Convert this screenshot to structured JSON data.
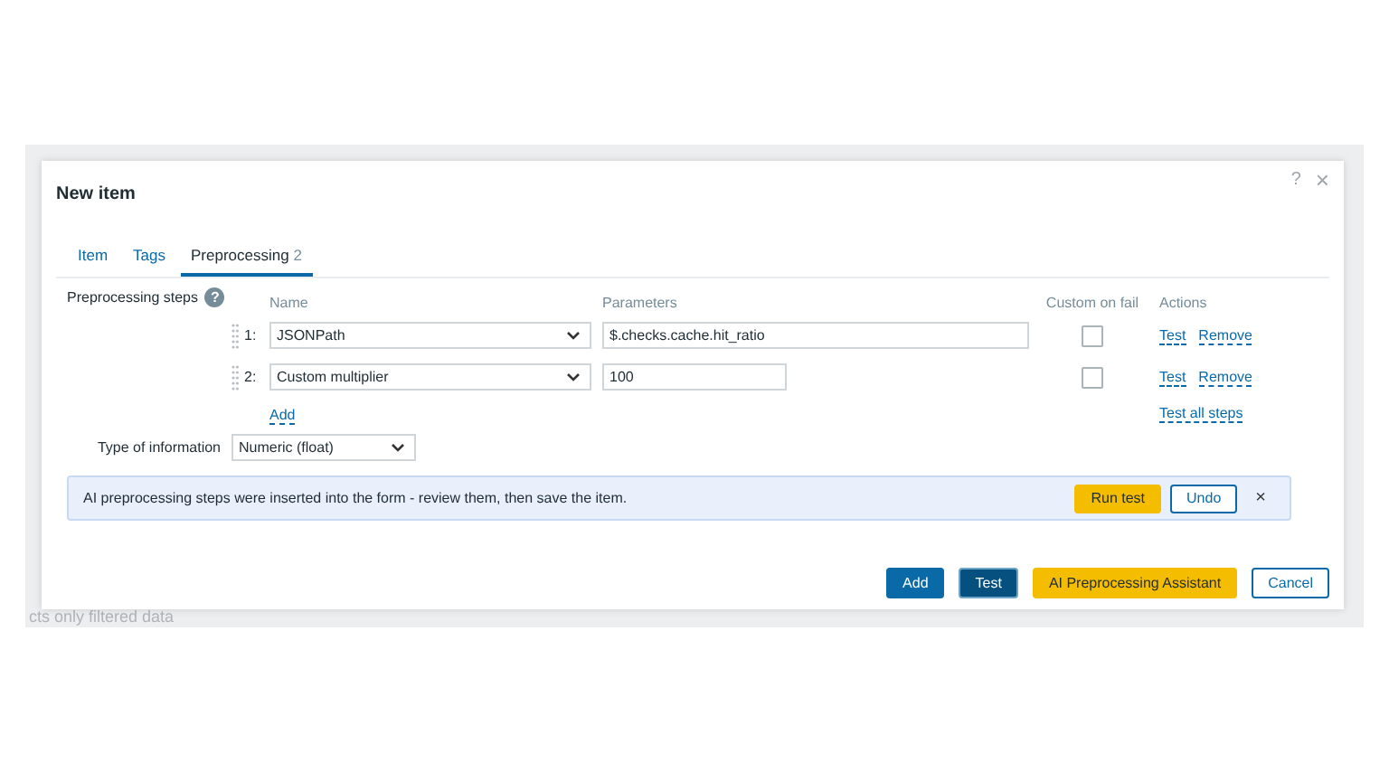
{
  "background": {
    "text": "cts only filtered data"
  },
  "dialog": {
    "title": "New item",
    "help": "?",
    "close": "×"
  },
  "tabs": [
    {
      "label": "Item",
      "selected": false
    },
    {
      "label": "Tags",
      "selected": false
    },
    {
      "label": "Preprocessing",
      "count": "2",
      "selected": true
    }
  ],
  "preprocessing": {
    "label": "Preprocessing steps",
    "help": "?",
    "columns": [
      "Name",
      "Parameters",
      "Custom on fail",
      "Actions"
    ],
    "steps": [
      {
        "number": "1:",
        "name": "JSONPath",
        "parameter": "$.checks.cache.hit_ratio",
        "wide": true,
        "custom_on_fail": false,
        "actions": [
          "Test",
          "Remove"
        ]
      },
      {
        "number": "2:",
        "name": "Custom multiplier",
        "parameter": "100",
        "wide": false,
        "custom_on_fail": false,
        "actions": [
          "Test",
          "Remove"
        ]
      }
    ],
    "add": "Add",
    "test_all": "Test all steps"
  },
  "type_of_information": {
    "label": "Type of information",
    "value": "Numeric (float)"
  },
  "alert": {
    "message": "AI preprocessing steps were inserted into the form - review them, then save the item.",
    "buttons": [
      {
        "label": "Run test",
        "kind": "warning"
      },
      {
        "label": "Undo",
        "kind": "outline"
      }
    ],
    "close": "×"
  },
  "footer_buttons": [
    {
      "label": "Add",
      "kind": "primary"
    },
    {
      "label": "Test",
      "kind": "primary-dark"
    },
    {
      "label": "AI Preprocessing Assistant",
      "kind": "warning"
    },
    {
      "label": "Cancel",
      "kind": "outline"
    }
  ]
}
